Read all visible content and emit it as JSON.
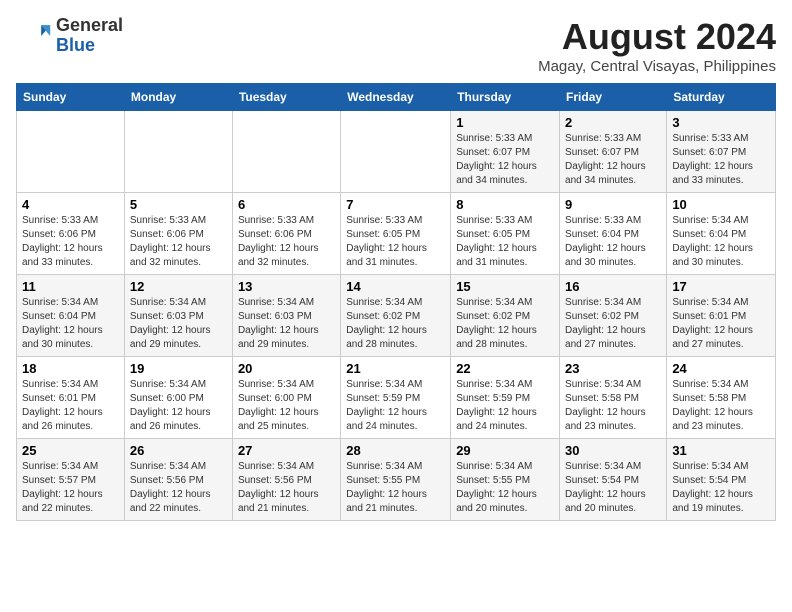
{
  "logo": {
    "line1": "General",
    "line2": "Blue"
  },
  "title": {
    "month_year": "August 2024",
    "location": "Magay, Central Visayas, Philippines"
  },
  "headers": [
    "Sunday",
    "Monday",
    "Tuesday",
    "Wednesday",
    "Thursday",
    "Friday",
    "Saturday"
  ],
  "weeks": [
    [
      {
        "day": "",
        "info": ""
      },
      {
        "day": "",
        "info": ""
      },
      {
        "day": "",
        "info": ""
      },
      {
        "day": "",
        "info": ""
      },
      {
        "day": "1",
        "info": "Sunrise: 5:33 AM\nSunset: 6:07 PM\nDaylight: 12 hours\nand 34 minutes."
      },
      {
        "day": "2",
        "info": "Sunrise: 5:33 AM\nSunset: 6:07 PM\nDaylight: 12 hours\nand 34 minutes."
      },
      {
        "day": "3",
        "info": "Sunrise: 5:33 AM\nSunset: 6:07 PM\nDaylight: 12 hours\nand 33 minutes."
      }
    ],
    [
      {
        "day": "4",
        "info": "Sunrise: 5:33 AM\nSunset: 6:06 PM\nDaylight: 12 hours\nand 33 minutes."
      },
      {
        "day": "5",
        "info": "Sunrise: 5:33 AM\nSunset: 6:06 PM\nDaylight: 12 hours\nand 32 minutes."
      },
      {
        "day": "6",
        "info": "Sunrise: 5:33 AM\nSunset: 6:06 PM\nDaylight: 12 hours\nand 32 minutes."
      },
      {
        "day": "7",
        "info": "Sunrise: 5:33 AM\nSunset: 6:05 PM\nDaylight: 12 hours\nand 31 minutes."
      },
      {
        "day": "8",
        "info": "Sunrise: 5:33 AM\nSunset: 6:05 PM\nDaylight: 12 hours\nand 31 minutes."
      },
      {
        "day": "9",
        "info": "Sunrise: 5:33 AM\nSunset: 6:04 PM\nDaylight: 12 hours\nand 30 minutes."
      },
      {
        "day": "10",
        "info": "Sunrise: 5:34 AM\nSunset: 6:04 PM\nDaylight: 12 hours\nand 30 minutes."
      }
    ],
    [
      {
        "day": "11",
        "info": "Sunrise: 5:34 AM\nSunset: 6:04 PM\nDaylight: 12 hours\nand 30 minutes."
      },
      {
        "day": "12",
        "info": "Sunrise: 5:34 AM\nSunset: 6:03 PM\nDaylight: 12 hours\nand 29 minutes."
      },
      {
        "day": "13",
        "info": "Sunrise: 5:34 AM\nSunset: 6:03 PM\nDaylight: 12 hours\nand 29 minutes."
      },
      {
        "day": "14",
        "info": "Sunrise: 5:34 AM\nSunset: 6:02 PM\nDaylight: 12 hours\nand 28 minutes."
      },
      {
        "day": "15",
        "info": "Sunrise: 5:34 AM\nSunset: 6:02 PM\nDaylight: 12 hours\nand 28 minutes."
      },
      {
        "day": "16",
        "info": "Sunrise: 5:34 AM\nSunset: 6:02 PM\nDaylight: 12 hours\nand 27 minutes."
      },
      {
        "day": "17",
        "info": "Sunrise: 5:34 AM\nSunset: 6:01 PM\nDaylight: 12 hours\nand 27 minutes."
      }
    ],
    [
      {
        "day": "18",
        "info": "Sunrise: 5:34 AM\nSunset: 6:01 PM\nDaylight: 12 hours\nand 26 minutes."
      },
      {
        "day": "19",
        "info": "Sunrise: 5:34 AM\nSunset: 6:00 PM\nDaylight: 12 hours\nand 26 minutes."
      },
      {
        "day": "20",
        "info": "Sunrise: 5:34 AM\nSunset: 6:00 PM\nDaylight: 12 hours\nand 25 minutes."
      },
      {
        "day": "21",
        "info": "Sunrise: 5:34 AM\nSunset: 5:59 PM\nDaylight: 12 hours\nand 24 minutes."
      },
      {
        "day": "22",
        "info": "Sunrise: 5:34 AM\nSunset: 5:59 PM\nDaylight: 12 hours\nand 24 minutes."
      },
      {
        "day": "23",
        "info": "Sunrise: 5:34 AM\nSunset: 5:58 PM\nDaylight: 12 hours\nand 23 minutes."
      },
      {
        "day": "24",
        "info": "Sunrise: 5:34 AM\nSunset: 5:58 PM\nDaylight: 12 hours\nand 23 minutes."
      }
    ],
    [
      {
        "day": "25",
        "info": "Sunrise: 5:34 AM\nSunset: 5:57 PM\nDaylight: 12 hours\nand 22 minutes."
      },
      {
        "day": "26",
        "info": "Sunrise: 5:34 AM\nSunset: 5:56 PM\nDaylight: 12 hours\nand 22 minutes."
      },
      {
        "day": "27",
        "info": "Sunrise: 5:34 AM\nSunset: 5:56 PM\nDaylight: 12 hours\nand 21 minutes."
      },
      {
        "day": "28",
        "info": "Sunrise: 5:34 AM\nSunset: 5:55 PM\nDaylight: 12 hours\nand 21 minutes."
      },
      {
        "day": "29",
        "info": "Sunrise: 5:34 AM\nSunset: 5:55 PM\nDaylight: 12 hours\nand 20 minutes."
      },
      {
        "day": "30",
        "info": "Sunrise: 5:34 AM\nSunset: 5:54 PM\nDaylight: 12 hours\nand 20 minutes."
      },
      {
        "day": "31",
        "info": "Sunrise: 5:34 AM\nSunset: 5:54 PM\nDaylight: 12 hours\nand 19 minutes."
      }
    ]
  ]
}
